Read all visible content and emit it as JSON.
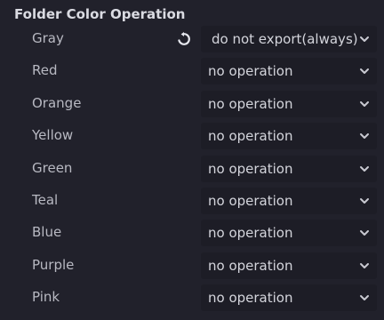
{
  "section": {
    "title": "Folder Color Operation"
  },
  "rows": [
    {
      "label": "Gray",
      "value": "do not export(always)",
      "modified": true
    },
    {
      "label": "Red",
      "value": "no operation",
      "modified": false
    },
    {
      "label": "Orange",
      "value": "no operation",
      "modified": false
    },
    {
      "label": "Yellow",
      "value": "no operation",
      "modified": false
    },
    {
      "label": "Green",
      "value": "no operation",
      "modified": false
    },
    {
      "label": "Teal",
      "value": "no operation",
      "modified": false
    },
    {
      "label": "Blue",
      "value": "no operation",
      "modified": false
    },
    {
      "label": "Purple",
      "value": "no operation",
      "modified": false
    },
    {
      "label": "Pink",
      "value": "no operation",
      "modified": false
    }
  ],
  "icons": {
    "revert": "revert-icon",
    "dropdown": "chevron-down-icon"
  },
  "colors": {
    "background": "#21212b",
    "select_background": "#1d1d26",
    "title_text": "#dadbe2",
    "label_text": "#b8b9c2",
    "value_text": "#d4d5dc"
  }
}
